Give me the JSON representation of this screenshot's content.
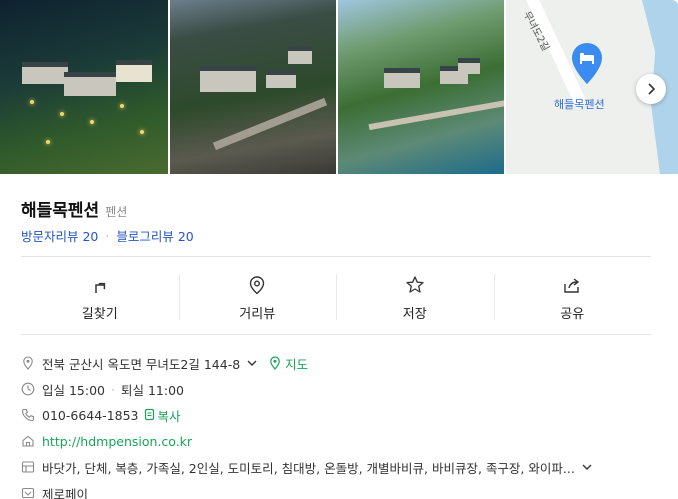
{
  "place": {
    "name": "해들목펜션",
    "category": "펜션",
    "visitor_reviews": "방문자리뷰 20",
    "blog_reviews": "블로그리뷰 20"
  },
  "map": {
    "road_label": "무녀도2길",
    "pin_label": "해들목펜션"
  },
  "actions": [
    {
      "label": "길찾기",
      "icon": "directions-icon"
    },
    {
      "label": "거리뷰",
      "icon": "location-pin-icon"
    },
    {
      "label": "저장",
      "icon": "star-icon"
    },
    {
      "label": "공유",
      "icon": "share-icon"
    }
  ],
  "info": {
    "address": "전북 군산시 옥도면 무녀도2길 144-8",
    "map_link": "지도",
    "checkin": "입실 15:00",
    "checkout": "퇴실 11:00",
    "phone": "010-6644-1853",
    "copy": "복사",
    "website": "http://hdmpension.co.kr",
    "amenities": "바닷가, 단체, 복층, 가족실, 2인실, 도미토리, 침대방, 온돌방, 개별바비큐, 바비큐장, 족구장, 와이파...",
    "payment": "제로페이"
  },
  "colors": {
    "accent_blue": "#2355c3",
    "accent_green": "#1aa35a",
    "map_pin": "#3b8cf0"
  }
}
